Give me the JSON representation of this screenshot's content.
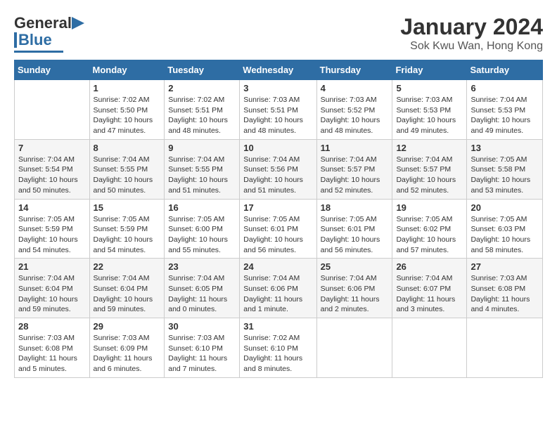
{
  "logo": {
    "line1": "General",
    "line2": "Blue"
  },
  "title": "January 2024",
  "subtitle": "Sok Kwu Wan, Hong Kong",
  "days_of_week": [
    "Sunday",
    "Monday",
    "Tuesday",
    "Wednesday",
    "Thursday",
    "Friday",
    "Saturday"
  ],
  "weeks": [
    [
      {
        "day": "",
        "info": ""
      },
      {
        "day": "1",
        "info": "Sunrise: 7:02 AM\nSunset: 5:50 PM\nDaylight: 10 hours\nand 47 minutes."
      },
      {
        "day": "2",
        "info": "Sunrise: 7:02 AM\nSunset: 5:51 PM\nDaylight: 10 hours\nand 48 minutes."
      },
      {
        "day": "3",
        "info": "Sunrise: 7:03 AM\nSunset: 5:51 PM\nDaylight: 10 hours\nand 48 minutes."
      },
      {
        "day": "4",
        "info": "Sunrise: 7:03 AM\nSunset: 5:52 PM\nDaylight: 10 hours\nand 48 minutes."
      },
      {
        "day": "5",
        "info": "Sunrise: 7:03 AM\nSunset: 5:53 PM\nDaylight: 10 hours\nand 49 minutes."
      },
      {
        "day": "6",
        "info": "Sunrise: 7:04 AM\nSunset: 5:53 PM\nDaylight: 10 hours\nand 49 minutes."
      }
    ],
    [
      {
        "day": "7",
        "info": "Sunrise: 7:04 AM\nSunset: 5:54 PM\nDaylight: 10 hours\nand 50 minutes."
      },
      {
        "day": "8",
        "info": "Sunrise: 7:04 AM\nSunset: 5:55 PM\nDaylight: 10 hours\nand 50 minutes."
      },
      {
        "day": "9",
        "info": "Sunrise: 7:04 AM\nSunset: 5:55 PM\nDaylight: 10 hours\nand 51 minutes."
      },
      {
        "day": "10",
        "info": "Sunrise: 7:04 AM\nSunset: 5:56 PM\nDaylight: 10 hours\nand 51 minutes."
      },
      {
        "day": "11",
        "info": "Sunrise: 7:04 AM\nSunset: 5:57 PM\nDaylight: 10 hours\nand 52 minutes."
      },
      {
        "day": "12",
        "info": "Sunrise: 7:04 AM\nSunset: 5:57 PM\nDaylight: 10 hours\nand 52 minutes."
      },
      {
        "day": "13",
        "info": "Sunrise: 7:05 AM\nSunset: 5:58 PM\nDaylight: 10 hours\nand 53 minutes."
      }
    ],
    [
      {
        "day": "14",
        "info": "Sunrise: 7:05 AM\nSunset: 5:59 PM\nDaylight: 10 hours\nand 54 minutes."
      },
      {
        "day": "15",
        "info": "Sunrise: 7:05 AM\nSunset: 5:59 PM\nDaylight: 10 hours\nand 54 minutes."
      },
      {
        "day": "16",
        "info": "Sunrise: 7:05 AM\nSunset: 6:00 PM\nDaylight: 10 hours\nand 55 minutes."
      },
      {
        "day": "17",
        "info": "Sunrise: 7:05 AM\nSunset: 6:01 PM\nDaylight: 10 hours\nand 56 minutes."
      },
      {
        "day": "18",
        "info": "Sunrise: 7:05 AM\nSunset: 6:01 PM\nDaylight: 10 hours\nand 56 minutes."
      },
      {
        "day": "19",
        "info": "Sunrise: 7:05 AM\nSunset: 6:02 PM\nDaylight: 10 hours\nand 57 minutes."
      },
      {
        "day": "20",
        "info": "Sunrise: 7:05 AM\nSunset: 6:03 PM\nDaylight: 10 hours\nand 58 minutes."
      }
    ],
    [
      {
        "day": "21",
        "info": "Sunrise: 7:04 AM\nSunset: 6:04 PM\nDaylight: 10 hours\nand 59 minutes."
      },
      {
        "day": "22",
        "info": "Sunrise: 7:04 AM\nSunset: 6:04 PM\nDaylight: 10 hours\nand 59 minutes."
      },
      {
        "day": "23",
        "info": "Sunrise: 7:04 AM\nSunset: 6:05 PM\nDaylight: 11 hours\nand 0 minutes."
      },
      {
        "day": "24",
        "info": "Sunrise: 7:04 AM\nSunset: 6:06 PM\nDaylight: 11 hours\nand 1 minute."
      },
      {
        "day": "25",
        "info": "Sunrise: 7:04 AM\nSunset: 6:06 PM\nDaylight: 11 hours\nand 2 minutes."
      },
      {
        "day": "26",
        "info": "Sunrise: 7:04 AM\nSunset: 6:07 PM\nDaylight: 11 hours\nand 3 minutes."
      },
      {
        "day": "27",
        "info": "Sunrise: 7:03 AM\nSunset: 6:08 PM\nDaylight: 11 hours\nand 4 minutes."
      }
    ],
    [
      {
        "day": "28",
        "info": "Sunrise: 7:03 AM\nSunset: 6:08 PM\nDaylight: 11 hours\nand 5 minutes."
      },
      {
        "day": "29",
        "info": "Sunrise: 7:03 AM\nSunset: 6:09 PM\nDaylight: 11 hours\nand 6 minutes."
      },
      {
        "day": "30",
        "info": "Sunrise: 7:03 AM\nSunset: 6:10 PM\nDaylight: 11 hours\nand 7 minutes."
      },
      {
        "day": "31",
        "info": "Sunrise: 7:02 AM\nSunset: 6:10 PM\nDaylight: 11 hours\nand 8 minutes."
      },
      {
        "day": "",
        "info": ""
      },
      {
        "day": "",
        "info": ""
      },
      {
        "day": "",
        "info": ""
      }
    ]
  ]
}
